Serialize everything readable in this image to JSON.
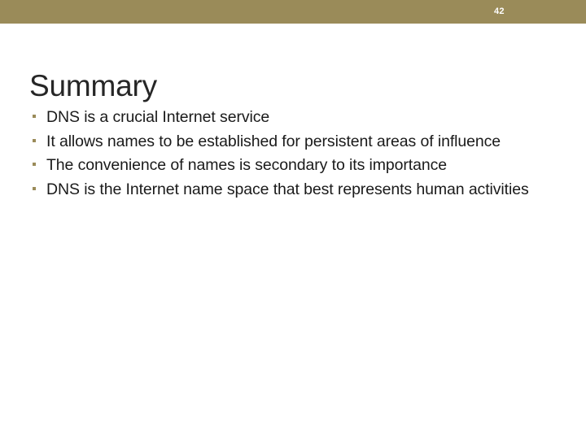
{
  "slide": {
    "page_number": "42",
    "title": "Summary",
    "header_color": "#9a8b59",
    "title_color": "#262626",
    "body_color": "#1a1a1a",
    "bullet_marker_color": "#9a8b59",
    "background_color": "#ffffff",
    "bullets": [
      {
        "text": "DNS is a crucial Internet service"
      },
      {
        "text": "It allows names to be established for persistent areas of influence"
      },
      {
        "text": "The convenience of names is secondary to its importance"
      },
      {
        "text": "DNS is the Internet name space that best represents human activities"
      }
    ]
  }
}
